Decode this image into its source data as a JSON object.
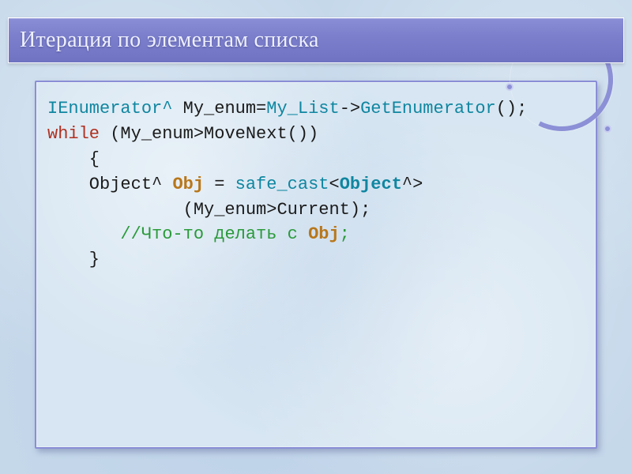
{
  "slide": {
    "title": "Итерация по элементам списка"
  },
  "code": {
    "line1_pre": "IEnumerator^ ",
    "line1_mid": "My_enum=",
    "line1_type": "My_List",
    "line1_arrow": "->",
    "line1_fn": "GetEnumerator",
    "line1_post": "();",
    "line2_kw": "while",
    "line2_rest": " (My_enum>MoveNext())",
    "line3": "    {",
    "line4_pre": "    Object^ ",
    "line4_obj": "Obj",
    "line4_eq": " = ",
    "line4_cast": "safe_cast",
    "line4_lt": "<",
    "line4_castT": "Object",
    "line4_caret": "^>",
    "line5": "             (My_enum>Current);",
    "line6_indent": "       ",
    "line6_comment_pre": "//Что-то делать с ",
    "line6_obj": "Obj",
    "line6_comment_post": ";",
    "line7": "    }"
  }
}
